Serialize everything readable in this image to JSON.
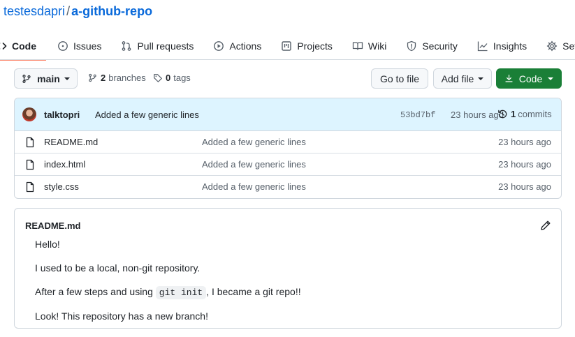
{
  "repo": {
    "owner": "testesdapri",
    "separator": "/",
    "name": "a-github-repo"
  },
  "tabs": [
    {
      "label": "Code",
      "icon": "code-icon",
      "active": true
    },
    {
      "label": "Issues",
      "icon": "issue-icon"
    },
    {
      "label": "Pull requests",
      "icon": "pull-request-icon"
    },
    {
      "label": "Actions",
      "icon": "play-icon"
    },
    {
      "label": "Projects",
      "icon": "project-icon"
    },
    {
      "label": "Wiki",
      "icon": "book-icon"
    },
    {
      "label": "Security",
      "icon": "shield-icon"
    },
    {
      "label": "Insights",
      "icon": "graph-icon"
    },
    {
      "label": "Settings",
      "icon": "gear-icon"
    }
  ],
  "toolbar": {
    "branch": "main",
    "branches_count": "2",
    "branches_label": "branches",
    "tags_count": "0",
    "tags_label": "tags",
    "go_to_file": "Go to file",
    "add_file": "Add file",
    "code": "Code"
  },
  "commit": {
    "author": "talktopri",
    "message": "Added a few generic lines",
    "sha": "53bd7bf",
    "time": "23 hours ago",
    "count": "1",
    "count_label": "commits"
  },
  "files": [
    {
      "name": "README.md",
      "message": "Added a few generic lines",
      "time": "23 hours ago"
    },
    {
      "name": "index.html",
      "message": "Added a few generic lines",
      "time": "23 hours ago"
    },
    {
      "name": "style.css",
      "message": "Added a few generic lines",
      "time": "23 hours ago"
    }
  ],
  "readme": {
    "title": "README.md",
    "line1": "Hello!",
    "line2": "I used to be a local, non-git repository.",
    "line3_before": "After a few steps and using ",
    "line3_code": "git init",
    "line3_after": ", I became a git repo!!",
    "line4": "Look! This repository has a new branch!"
  },
  "colors": {
    "accent": "#0969da",
    "tab_underline": "#fd8c73",
    "code_button": "#1a7f37",
    "commit_bar": "#ddf4ff"
  }
}
